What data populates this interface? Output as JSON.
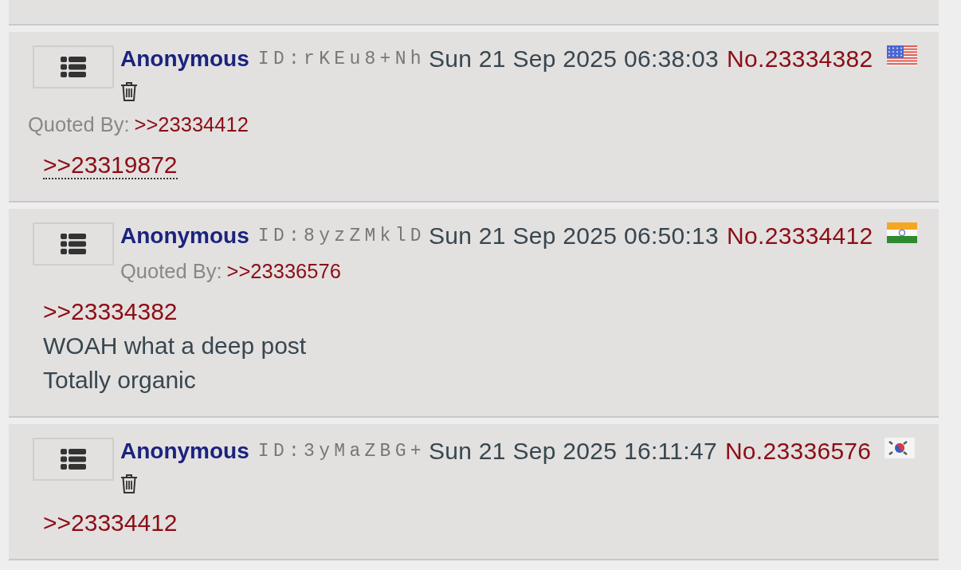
{
  "posts": [
    {
      "name": "Anonymous",
      "poster_id": "ID:rKEu8+Nh",
      "date": "Sun 21 Sep 2025 06:38:03",
      "number": "No.23334382",
      "flag": {
        "kind": "us"
      },
      "deletable": true,
      "quoted_by_label": "Quoted By:",
      "quoted_by": [
        ">>23334412"
      ],
      "body": [
        {
          "kind": "quote",
          "text": ">>23319872",
          "hovered": true
        }
      ]
    },
    {
      "name": "Anonymous",
      "poster_id": "ID:8yzZMklD",
      "date": "Sun 21 Sep 2025 06:50:13",
      "number": "No.23334412",
      "flag": {
        "kind": "in"
      },
      "deletable": false,
      "quoted_by_label": "Quoted By:",
      "quoted_by": [
        ">>23336576"
      ],
      "body": [
        {
          "kind": "quote",
          "text": ">>23334382",
          "hovered": false
        },
        {
          "kind": "text",
          "text": "WOAH what a deep post"
        },
        {
          "kind": "text",
          "text": "Totally organic"
        }
      ]
    },
    {
      "name": "Anonymous",
      "poster_id": "ID:3yMaZBG+",
      "date": "Sun 21 Sep 2025 16:11:47",
      "number": "No.23336576",
      "flag": {
        "kind": "kr"
      },
      "deletable": true,
      "body": [
        {
          "kind": "quote",
          "text": ">>23334412",
          "hovered": false
        }
      ]
    }
  ]
}
